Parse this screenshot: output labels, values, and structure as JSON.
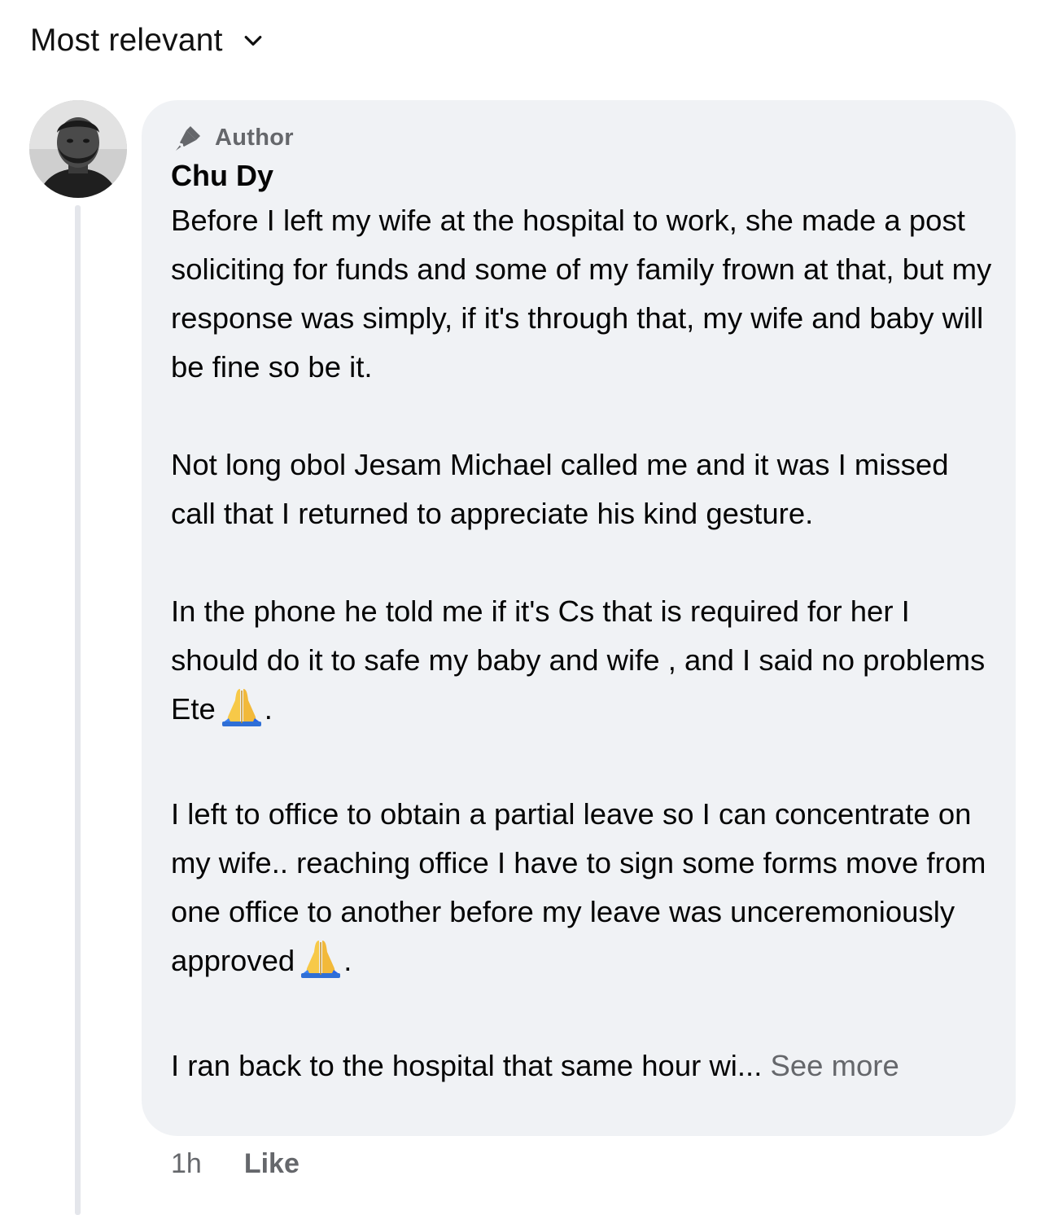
{
  "sort": {
    "label": "Most relevant",
    "icon": "chevron-down-icon"
  },
  "comment": {
    "avatar_icon": "profile-photo",
    "badge": {
      "icon": "microphone-pen-icon",
      "label": "Author"
    },
    "author_name": "Chu Dy",
    "paragraphs": [
      "Before I left my wife at the hospital to work, she made a post soliciting for funds and some of my family frown at that, but my response was simply, if it's through that, my wife and baby will be fine so be it.",
      "Not long obol Jesam Michael called me and it was I missed call that I returned to appreciate his kind gesture.",
      "In the phone he told me if it's Cs that is required for her I should do it to safe my baby and wife , and I said no problems Ete",
      "I left to office to obtain a partial leave so I can concentrate on my wife.. reaching office I have to sign some forms move from one office to another before my leave was unceremoniously approved",
      "I ran back to the hospital that same hour wi..."
    ],
    "emoji_name": "folded-hands-emoji",
    "period": ".",
    "see_more": "See more",
    "timestamp": "1h",
    "like_label": "Like"
  },
  "colors": {
    "bubble": "#f0f2f5",
    "secondary_text": "#65676b",
    "primary_text": "#050505",
    "thread_line": "#e4e6eb"
  }
}
